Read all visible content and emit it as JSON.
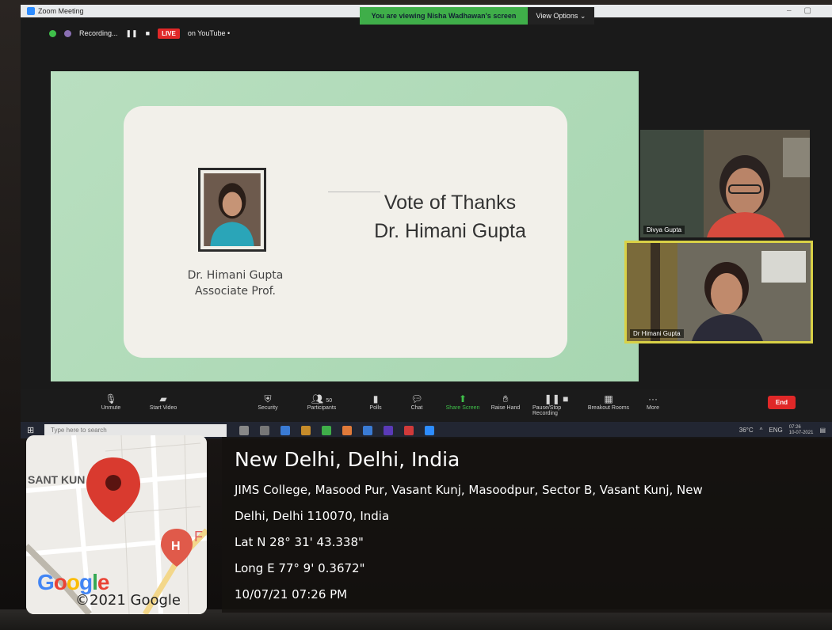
{
  "zoom": {
    "window_title": "Zoom Meeting",
    "viewing_banner": "You are viewing Nisha Wadhawan's screen",
    "view_options_label": "View Options ⌄",
    "recording_label": "Recording...",
    "live_label": "LIVE",
    "live_destination": "on YouTube •"
  },
  "slide": {
    "heading_line1": "Vote of Thanks",
    "heading_line2": "Dr. Himani Gupta",
    "speaker_name": "Dr. Himani Gupta",
    "speaker_title": "Associate Prof."
  },
  "participants": [
    {
      "name": "Divya Gupta"
    },
    {
      "name": "Dr Himani Gupta"
    }
  ],
  "toolbar": {
    "items": [
      {
        "label": "Unmute",
        "icon": "mic-muted-icon"
      },
      {
        "label": "Start Video",
        "icon": "video-off-icon"
      },
      {
        "label": "Security",
        "icon": "shield-icon"
      },
      {
        "label": "Participants",
        "icon": "participants-icon",
        "count": "50"
      },
      {
        "label": "Polls",
        "icon": "polls-icon"
      },
      {
        "label": "Chat",
        "icon": "chat-icon"
      },
      {
        "label": "Share Screen",
        "icon": "share-screen-icon"
      },
      {
        "label": "Raise Hand",
        "icon": "hand-icon"
      },
      {
        "label": "Pause/Stop Recording",
        "icon": "pause-recording-icon"
      },
      {
        "label": "Breakout Rooms",
        "icon": "breakout-icon"
      },
      {
        "label": "More",
        "icon": "more-icon"
      }
    ],
    "end_label": "End"
  },
  "taskbar": {
    "search_placeholder": "Type here to search",
    "temperature": "36°C",
    "language": "ENG",
    "time": "07:26",
    "date": "10-07-2021"
  },
  "gps": {
    "location_title": "New Delhi, Delhi, India",
    "address_line1": "JIMS College, Masood Pur, Vasant Kunj, Masoodpur, Sector B, Vasant Kunj, New",
    "address_line2": "Delhi, Delhi 110070, India",
    "latitude": "Lat N 28° 31' 43.338\"",
    "longitude": "Long E 77° 9' 0.3672\"",
    "datetime": "10/07/21 07:26 PM"
  },
  "map": {
    "area_label": "SANT KUN",
    "poi_letter": "F",
    "copyright": "©2021 Google"
  },
  "colors": {
    "live_red": "#e02828",
    "banner_green": "#3fae49",
    "pin_red": "#d93a2f",
    "active_speaker_border": "#d9d146"
  }
}
